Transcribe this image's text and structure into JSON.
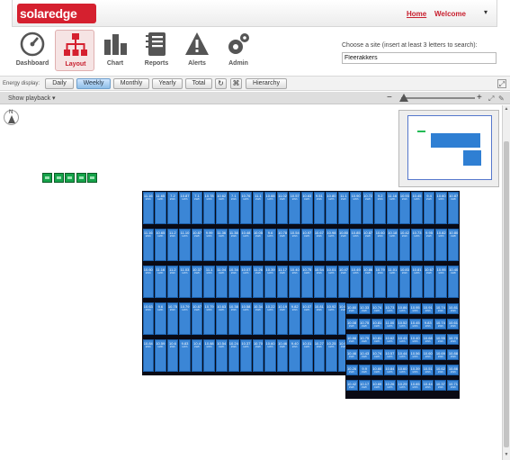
{
  "header": {
    "logo_text": "solaredge",
    "home_link": "Home",
    "welcome": "Welcome",
    "user_menu_icon": "caret-down-icon"
  },
  "nav": {
    "items": [
      {
        "label": "Dashboard",
        "icon": "gauge-icon",
        "active": false
      },
      {
        "label": "Layout",
        "icon": "sitemap-icon",
        "active": true
      },
      {
        "label": "Chart",
        "icon": "bar-chart-icon",
        "active": false
      },
      {
        "label": "Reports",
        "icon": "notebook-icon",
        "active": false
      },
      {
        "label": "Alerts",
        "icon": "warning-icon",
        "active": false
      },
      {
        "label": "Admin",
        "icon": "gears-icon",
        "active": false
      }
    ]
  },
  "site_search": {
    "label": "Choose a site (insert at least 3 letters to search):",
    "value": "Fleerakkers"
  },
  "energy_display": {
    "label": "Energy display:",
    "periods": [
      "Daily",
      "Weekly",
      "Monthly",
      "Yearly",
      "Total"
    ],
    "selected": "Weekly",
    "hierarchy": "Hierarchy",
    "refresh_icon": "refresh-icon",
    "tree_icon": "tree-icon",
    "expand_icon": "expand-icon"
  },
  "playback": {
    "label": "Show playback ▾",
    "zoom_minus": "−",
    "zoom_plus": "+",
    "fit_icon": "fit-screen-icon",
    "settings_icon": "settings-icon"
  },
  "layout": {
    "north_label": "N",
    "inverter_count": 5,
    "array1_rows": [
      [
        "11.16",
        "11.65",
        "7.2",
        "10.87",
        "7.1",
        "10.78",
        "10.62",
        "7.1",
        "10.76",
        "11.1",
        "10.88",
        "11.02",
        "10.57",
        "10.63",
        "9.51",
        "10.80",
        "11.1",
        "10.90",
        "10.72",
        "9.2",
        "11.16",
        "10.93",
        "10.45",
        "9.4",
        "10.60",
        "10.87"
      ],
      [
        "11.16",
        "10.65",
        "11.2",
        "11.10",
        "10.87",
        "9.99",
        "11.36",
        "11.38",
        "10.48",
        "10.05",
        "9.6",
        "10.78",
        "10.54",
        "10.97",
        "10.67",
        "10.98",
        "10.80",
        "10.85",
        "10.87",
        "10.60",
        "10.18",
        "10.42",
        "10.73",
        "9.95",
        "10.82",
        "10.80"
      ],
      [
        "10.60",
        "11.16",
        "11.2",
        "11.03",
        "10.37",
        "11.1",
        "11.04",
        "10.34",
        "10.07",
        "11.26",
        "10.39",
        "11.17",
        "10.40",
        "10.75",
        "10.54",
        "10.01",
        "10.47",
        "10.49",
        "10.86",
        "10.79",
        "11.01",
        "10.83",
        "10.81",
        "10.67",
        "10.95",
        "10.40"
      ],
      [
        "10.63",
        "9.6",
        "10.75",
        "10.79",
        "10.87",
        "10.79",
        "10.63",
        "10.38",
        "10.58",
        "10.34",
        "10.22",
        "10.19",
        "9.82",
        "10.07",
        "10.81",
        "10.92",
        "10.60",
        "10.69",
        "10.46",
        "10.85",
        "10.46",
        "11.11",
        "10.65",
        "10.2",
        "9.73",
        "10.60"
      ],
      [
        "10.84",
        "10.59",
        "10.6",
        "9.83",
        "10.4",
        "10.88",
        "10.54",
        "10.24",
        "10.37",
        "10.70",
        "10.60",
        "10.46",
        "9.40",
        "10.01",
        "10.27",
        "10.25",
        "10.95",
        "11.02",
        "10.85",
        "10.64",
        "11.00",
        "10.19",
        "10.08",
        "9.7",
        "10.95",
        "10.24"
      ]
    ],
    "array2_rows": [
      [
        "10.80",
        "10.33",
        "10.74",
        "10.73",
        "10.86",
        "10.95",
        "10.91",
        "10.74",
        "10.81"
      ],
      [
        "10.08",
        "10.75",
        "10.81",
        "11.00",
        "10.52",
        "10.45",
        "9.83",
        "10.74",
        "10.61"
      ],
      [
        "10.88",
        "10.75",
        "10.81",
        "10.62",
        "10.43",
        "10.40",
        "10.68",
        "10.55",
        "10.70"
      ],
      [
        "10.46",
        "10.43",
        "10.74",
        "10.57",
        "10.44",
        "10.56",
        "10.60",
        "10.69",
        "10.88"
      ],
      [
        "10.26",
        "9.9",
        "10.60",
        "10.84",
        "10.60",
        "10.39",
        "10.51",
        "10.62",
        "10.86"
      ],
      [
        "10.42",
        "10.17",
        "10.69",
        "10.26",
        "10.29",
        "10.65",
        "10.44",
        "10.37",
        "10.71"
      ]
    ],
    "module_unit": "kWh",
    "colors": {
      "module": "#3b86d6",
      "inverter": "#16a34a",
      "brand": "#d5202f"
    }
  }
}
